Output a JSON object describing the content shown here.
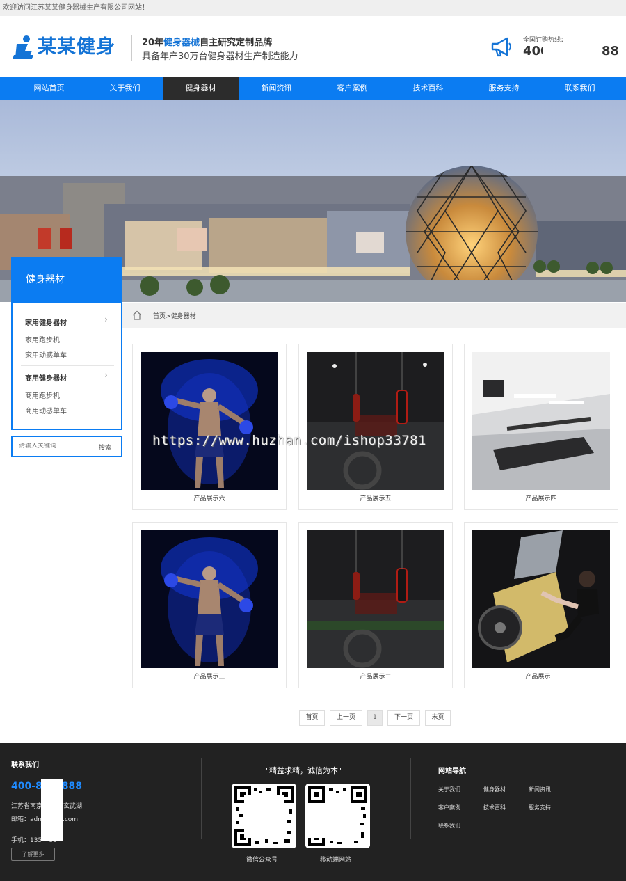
{
  "topbar": {
    "welcome": "欢迎访问江苏某某健身器械生产有限公司网站！"
  },
  "header": {
    "logo_text": "某某健身",
    "slogan_prefix": "20年",
    "slogan_highlight": "健身器械",
    "slogan_suffix": "自主研究定制品牌",
    "slogan_line2": "具备年产30万台健身器材生产制造能力",
    "hotline_label": "全国订购热线：",
    "hotline_number_visible": "400",
    "hotline_number_tail": "88"
  },
  "nav": {
    "items": [
      {
        "label": "网站首页"
      },
      {
        "label": "关于我们"
      },
      {
        "label": "健身器材",
        "active": true
      },
      {
        "label": "新闻资讯"
      },
      {
        "label": "客户案例"
      },
      {
        "label": "技术百科"
      },
      {
        "label": "服务支持"
      },
      {
        "label": "联系我们"
      }
    ]
  },
  "sidebar": {
    "title": "健身器材",
    "categories": [
      {
        "label": "家用健身器材",
        "subs": [
          "家用跑步机",
          "家用动感单车"
        ]
      },
      {
        "label": "商用健身器材",
        "subs": [
          "商用跑步机",
          "商用动感单车"
        ]
      }
    ],
    "search_placeholder": "请输入关键词",
    "search_button": "搜索"
  },
  "breadcrumb": {
    "home": "首页",
    "sep": ">",
    "current": "健身器材"
  },
  "products": [
    {
      "caption": "产品展示六",
      "image": "fighter-blue"
    },
    {
      "caption": "产品展示五",
      "image": "boxing-gym"
    },
    {
      "caption": "产品展示四",
      "image": "treadmill-room"
    },
    {
      "caption": "产品展示三",
      "image": "fighter-blue"
    },
    {
      "caption": "产品展示二",
      "image": "boxing-gym"
    },
    {
      "caption": "产品展示一",
      "image": "leg-press-woman"
    }
  ],
  "watermark": "https://www.huzhan.com/ishop33781",
  "pagination": {
    "first": "首页",
    "prev": "上一页",
    "current": "1",
    "next": "下一页",
    "last": "末页"
  },
  "footer": {
    "contact_title": "联系我们",
    "phone_visible": "400-8",
    "phone_tail": "888",
    "address_prefix": "江苏省南京",
    "address_suffix": "玄武湖",
    "email_prefix": "邮箱：adm",
    "email_suffix": "min.com",
    "mobile_prefix": "手机：135",
    "mobile_suffix": "88",
    "more_button": "了解更多",
    "quote": "\"精益求精，诚信为本\"",
    "qr_wechat_caption": "微信公众号",
    "qr_mobile_caption": "移动端网站",
    "nav_title": "网站导航",
    "nav_links": [
      "关于我们",
      "健身器材",
      "新闻资讯",
      "客户案例",
      "技术百科",
      "服务支持",
      "联系我们"
    ]
  },
  "colors": {
    "brand_blue": "#0b7cf2",
    "footer_bg": "#222222",
    "nav_active": "#2c2c2c"
  }
}
